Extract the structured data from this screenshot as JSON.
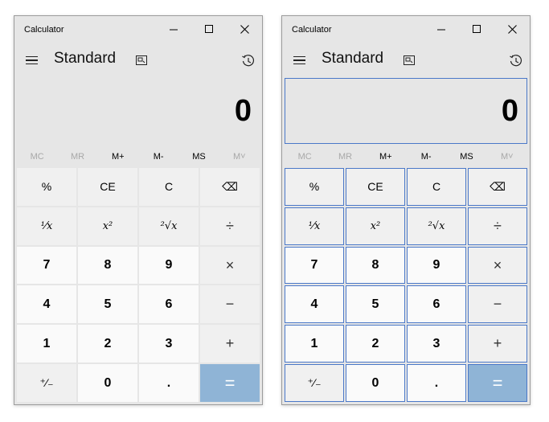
{
  "windows": [
    {
      "title": "Calculator",
      "mode": "Standard",
      "display_value": "0",
      "memory": [
        {
          "label": "MC",
          "enabled": false
        },
        {
          "label": "MR",
          "enabled": false
        },
        {
          "label": "M+",
          "enabled": true
        },
        {
          "label": "M-",
          "enabled": true
        },
        {
          "label": "MS",
          "enabled": true
        },
        {
          "label": "M˅",
          "enabled": false
        }
      ],
      "keys": {
        "percent": "%",
        "ce": "CE",
        "c": "C",
        "backspace": "⌫",
        "reciprocal": "¹⁄x",
        "square": "x²",
        "sqrt": "²√x",
        "divide": "÷",
        "seven": "7",
        "eight": "8",
        "nine": "9",
        "multiply": "×",
        "four": "4",
        "five": "5",
        "six": "6",
        "minus": "−",
        "one": "1",
        "two": "2",
        "three": "3",
        "plus": "+",
        "negate": "⁺⁄₋",
        "zero": "0",
        "decimal": ".",
        "equals": "="
      }
    },
    {
      "title": "Calculator",
      "mode": "Standard",
      "display_value": "0",
      "memory": [
        {
          "label": "MC",
          "enabled": false
        },
        {
          "label": "MR",
          "enabled": false
        },
        {
          "label": "M+",
          "enabled": true
        },
        {
          "label": "M-",
          "enabled": true
        },
        {
          "label": "MS",
          "enabled": true
        },
        {
          "label": "M˅",
          "enabled": false
        }
      ],
      "keys": {
        "percent": "%",
        "ce": "CE",
        "c": "C",
        "backspace": "⌫",
        "reciprocal": "¹⁄x",
        "square": "x²",
        "sqrt": "²√x",
        "divide": "÷",
        "seven": "7",
        "eight": "8",
        "nine": "9",
        "multiply": "×",
        "four": "4",
        "five": "5",
        "six": "6",
        "minus": "−",
        "one": "1",
        "two": "2",
        "three": "3",
        "plus": "+",
        "negate": "⁺⁄₋",
        "zero": "0",
        "decimal": ".",
        "equals": "="
      }
    }
  ],
  "colors": {
    "outline": "#4a78c8",
    "equals_bg": "#8fb4d6",
    "app_bg": "#e6e6e6"
  }
}
